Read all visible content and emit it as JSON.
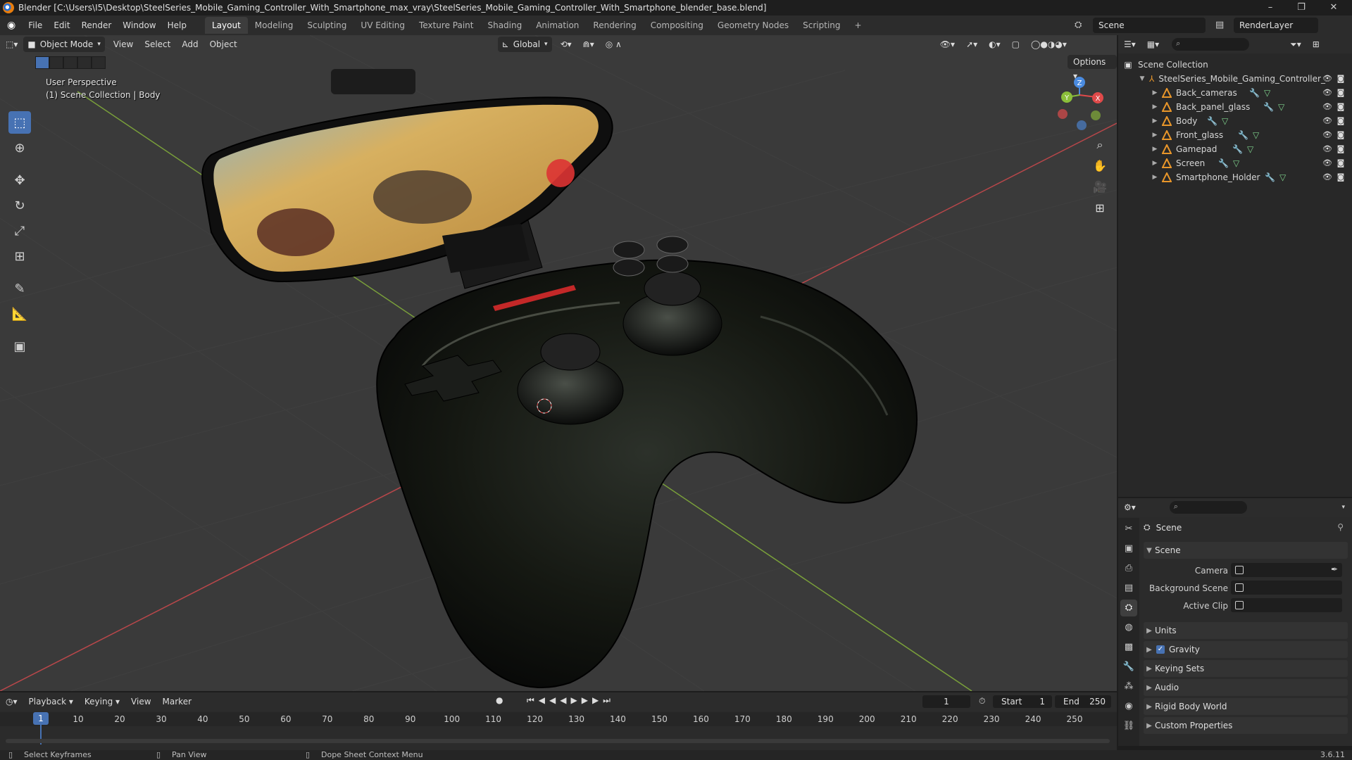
{
  "window": {
    "title": "Blender [C:\\Users\\I5\\Desktop\\SteelSeries_Mobile_Gaming_Controller_With_Smartphone_max_vray\\SteelSeries_Mobile_Gaming_Controller_With_Smartphone_blender_base.blend]",
    "controls": [
      "–",
      "❐",
      "✕"
    ]
  },
  "menu": [
    "File",
    "Edit",
    "Render",
    "Window",
    "Help"
  ],
  "workspaces": {
    "tabs": [
      "Layout",
      "Modeling",
      "Sculpting",
      "UV Editing",
      "Texture Paint",
      "Shading",
      "Animation",
      "Rendering",
      "Compositing",
      "Geometry Nodes",
      "Scripting"
    ],
    "active": "Layout",
    "add": "+"
  },
  "scene_selector": {
    "scene": "Scene",
    "view_layer": "RenderLayer"
  },
  "viewport": {
    "mode": "Object Mode",
    "menus": [
      "View",
      "Select",
      "Add",
      "Object"
    ],
    "transform_orientation": "Global",
    "options_label": "Options",
    "info_line1": "User Perspective",
    "info_line2": "(1) Scene Collection | Body",
    "gizmo": {
      "x": "X",
      "y": "Y",
      "z": "Z"
    }
  },
  "outliner": {
    "root": "Scene Collection",
    "collection": "SteelSeries_Mobile_Gaming_Controller_",
    "objects": [
      "Back_cameras",
      "Back_panel_glass",
      "Body",
      "Front_glass",
      "Gamepad",
      "Screen",
      "Smartphone_Holder"
    ]
  },
  "properties": {
    "context": "Scene",
    "section_scene": "Scene",
    "camera_label": "Camera",
    "background_scene_label": "Background Scene",
    "active_clip_label": "Active Clip",
    "sections": [
      "Units",
      "Gravity",
      "Keying Sets",
      "Audio",
      "Rigid Body World",
      "Custom Properties"
    ],
    "gravity_checked": true
  },
  "timeline": {
    "menus": [
      "Playback",
      "Keying",
      "View",
      "Marker"
    ],
    "current_frame": "1",
    "start_label": "Start",
    "start": "1",
    "end_label": "End",
    "end": "250",
    "ticks": [
      "10",
      "20",
      "30",
      "40",
      "50",
      "60",
      "70",
      "80",
      "90",
      "100",
      "110",
      "120",
      "130",
      "140",
      "150",
      "160",
      "170",
      "180",
      "190",
      "200",
      "210",
      "220",
      "230",
      "240",
      "250"
    ]
  },
  "statusbar": {
    "select": "Select Keyframes",
    "pan": "Pan View",
    "context": "Dope Sheet Context Menu",
    "version": "3.6.11"
  },
  "colors": {
    "accent": "#4772b3",
    "object_orange": "#e8962a",
    "x_axis": "#e04a4a",
    "y_axis": "#8bbf3a",
    "z_axis": "#4a8be0"
  }
}
